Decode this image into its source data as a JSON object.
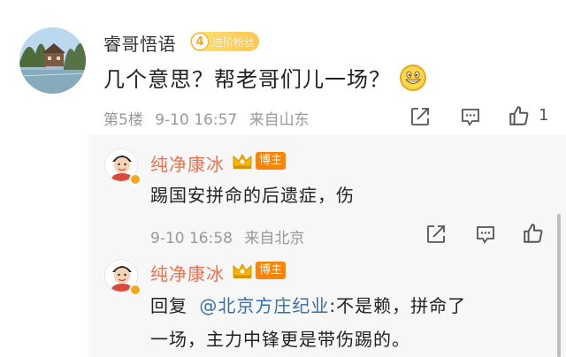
{
  "comment": {
    "username": "睿哥悟语",
    "fan_badge": {
      "level": "4",
      "label": "进阶粉丝"
    },
    "text": "几个意思？帮老哥们儿一场？",
    "floor": "第5楼",
    "time": "9-10 16:57",
    "location": "来自山东",
    "like_count": "1"
  },
  "replies": [
    {
      "username": "纯净康冰",
      "badge": "博主",
      "text": "踢国安拼命的后遗症，伤",
      "time": "9-10 16:58",
      "location": "来自北京"
    },
    {
      "username": "纯净康冰",
      "badge": "博主",
      "reply_prefix": "回复",
      "mention": "@北京方庄纪业",
      "text_line1": ":不是赖，拼命了",
      "text_line2": "一场，主力中锋更是带伤踢的。"
    }
  ],
  "icons": [
    "share-icon",
    "comment-icon",
    "like-icon"
  ],
  "colors": {
    "name_highlight": "#eb7350",
    "mention": "#3a6ea5",
    "badge_orange": "#ff8200",
    "meta_gray": "#999999"
  }
}
